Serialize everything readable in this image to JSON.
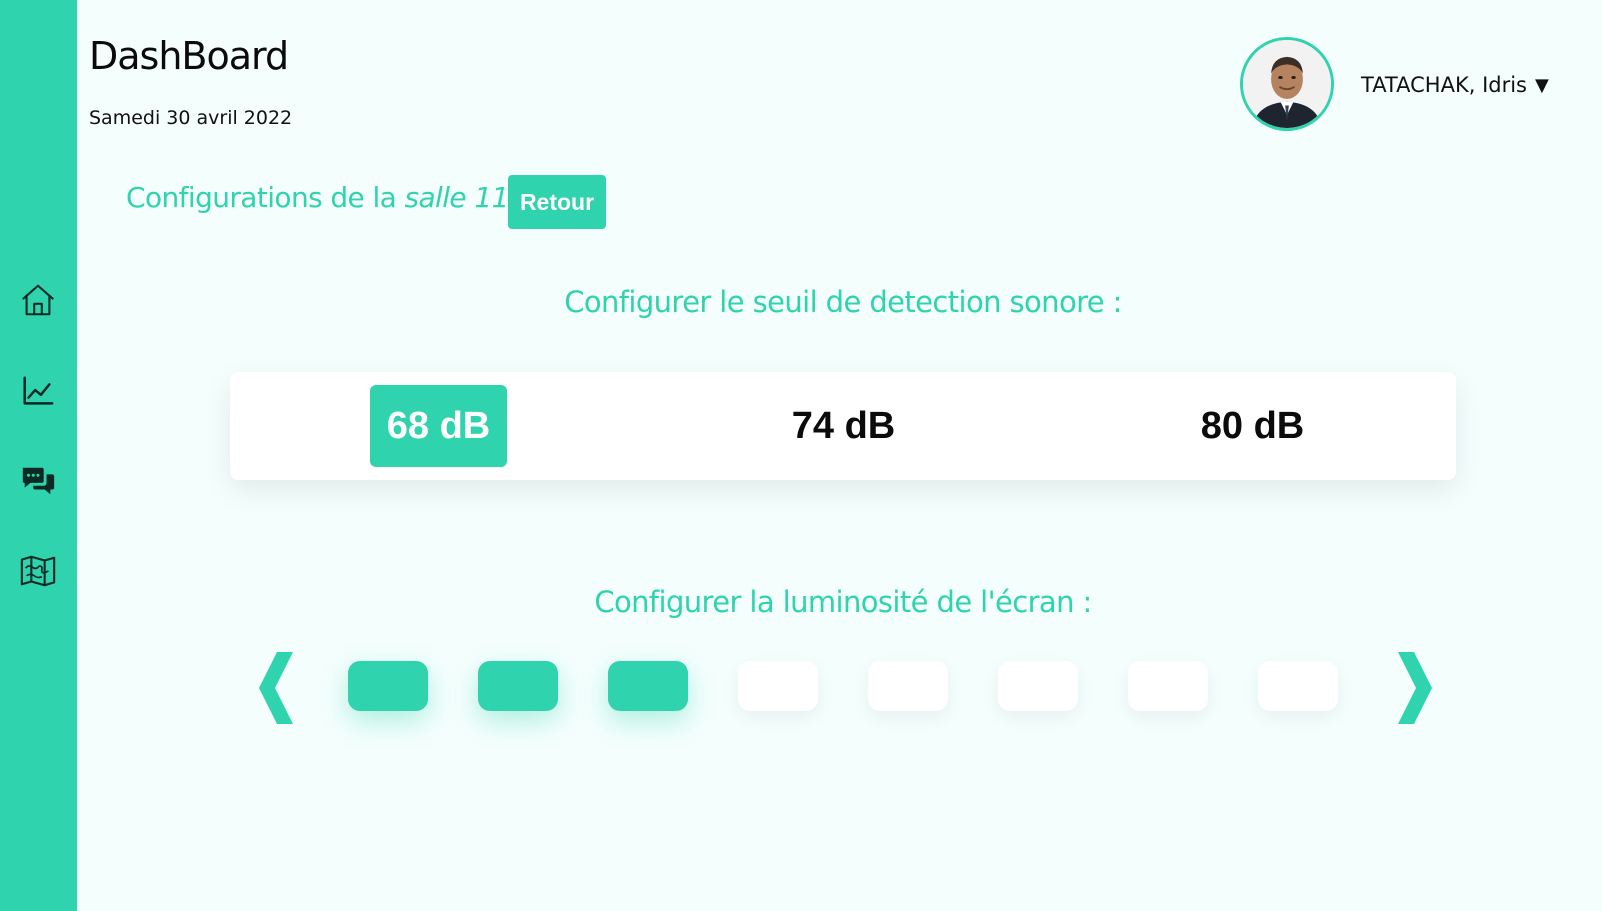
{
  "header": {
    "title": "DashBoard",
    "date": "Samedi 30 avril 2022",
    "user_name": "TATACHAK, Idris",
    "caret": "▼",
    "avatar_icon": "user-avatar"
  },
  "sidebar": {
    "items": [
      {
        "icon": "home-icon"
      },
      {
        "icon": "chart-line-icon"
      },
      {
        "icon": "chat-bubbles-icon"
      },
      {
        "icon": "map-icon"
      }
    ]
  },
  "config": {
    "heading_prefix": "Configurations de la ",
    "room": "salle 11",
    "heading_suffix": " :",
    "back_label": "Retour"
  },
  "sound": {
    "title": "Configurer le seuil de detection sonore :",
    "options": [
      "68 dB",
      "74 dB",
      "80 dB"
    ],
    "selected": "68 dB"
  },
  "brightness": {
    "title": "Configurer la luminosité de l'écran :",
    "prev_label": "❮",
    "next_label": "❯",
    "level": 3,
    "max_level": 8
  },
  "colors": {
    "accent": "#2fd3ae",
    "background": "#f4fefd",
    "panel": "#ffffff",
    "text": "#0b0b0b"
  }
}
